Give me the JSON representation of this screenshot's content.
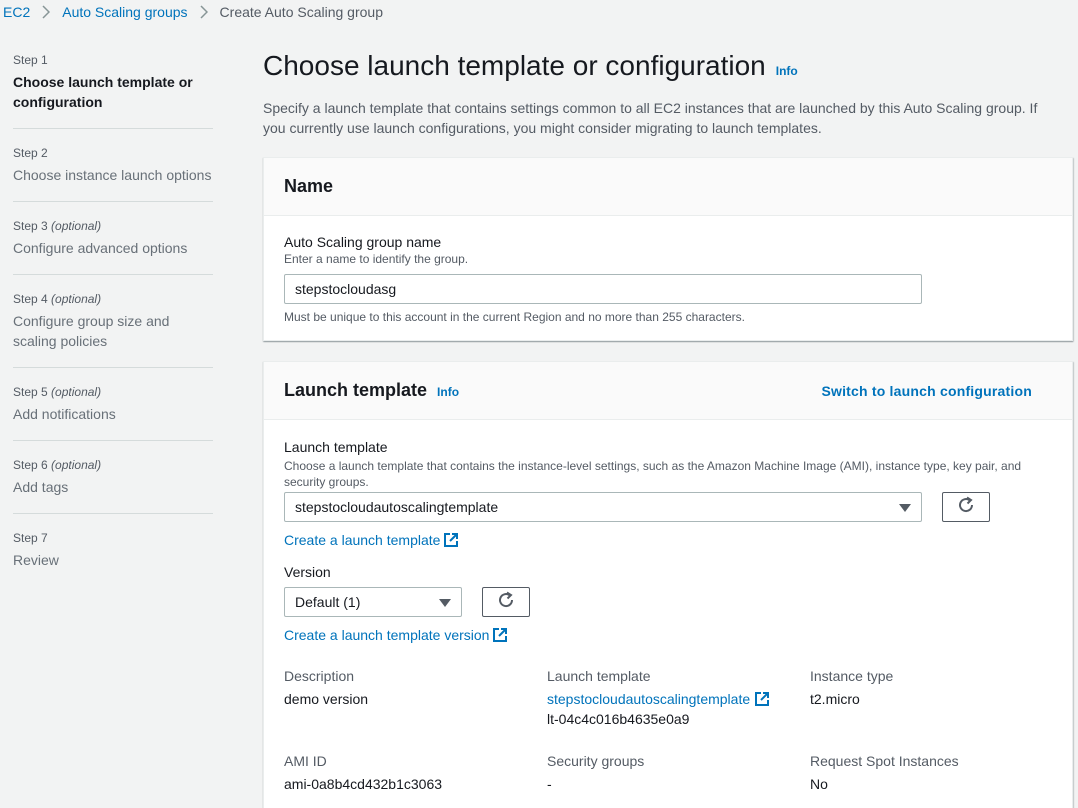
{
  "breadcrumb": {
    "items": [
      "EC2",
      "Auto Scaling groups"
    ],
    "current": "Create Auto Scaling group"
  },
  "steps": [
    {
      "num": "Step 1",
      "optional": "",
      "title": "Choose launch template or configuration"
    },
    {
      "num": "Step 2",
      "optional": "",
      "title": "Choose instance launch options"
    },
    {
      "num": "Step 3",
      "optional": "(optional)",
      "title": "Configure advanced options"
    },
    {
      "num": "Step 4",
      "optional": "(optional)",
      "title": "Configure group size and scaling policies"
    },
    {
      "num": "Step 5",
      "optional": "(optional)",
      "title": "Add notifications"
    },
    {
      "num": "Step 6",
      "optional": "(optional)",
      "title": "Add tags"
    },
    {
      "num": "Step 7",
      "optional": "",
      "title": "Review"
    }
  ],
  "page": {
    "title": "Choose launch template or configuration",
    "info": "Info",
    "description": "Specify a launch template that contains settings common to all EC2 instances that are launched by this Auto Scaling group. If you currently use launch configurations, you might consider migrating to launch templates."
  },
  "name_panel": {
    "title": "Name",
    "field_label": "Auto Scaling group name",
    "field_hint": "Enter a name to identify the group.",
    "field_value": "stepstocloudasg",
    "constraint": "Must be unique to this account in the current Region and no more than 255 characters."
  },
  "launch_panel": {
    "title": "Launch template",
    "info": "Info",
    "switch_link": "Switch to launch configuration",
    "lt_label": "Launch template",
    "lt_hint": "Choose a launch template that contains the instance-level settings, such as the Amazon Machine Image (AMI), instance type, key pair, and security groups.",
    "lt_selected": "stepstocloudautoscalingtemplate",
    "create_lt_link": "Create a launch template",
    "version_label": "Version",
    "version_selected": "Default (1)",
    "create_version_link": "Create a launch template version",
    "details": {
      "description_label": "Description",
      "description_value": "demo version",
      "lt_label": "Launch template",
      "lt_link": "stepstocloudautoscalingtemplate",
      "lt_id": "lt-04c4c016b4635e0a9",
      "instance_type_label": "Instance type",
      "instance_type_value": "t2.micro",
      "ami_label": "AMI ID",
      "ami_value": "ami-0a8b4cd432b1c3063",
      "sg_label": "Security groups",
      "sg_value": "-",
      "spot_label": "Request Spot Instances",
      "spot_value": "No"
    }
  },
  "colors": {
    "link": "#0073bb",
    "text": "#16191f",
    "muted": "#545b64",
    "background": "#f2f3f3"
  }
}
